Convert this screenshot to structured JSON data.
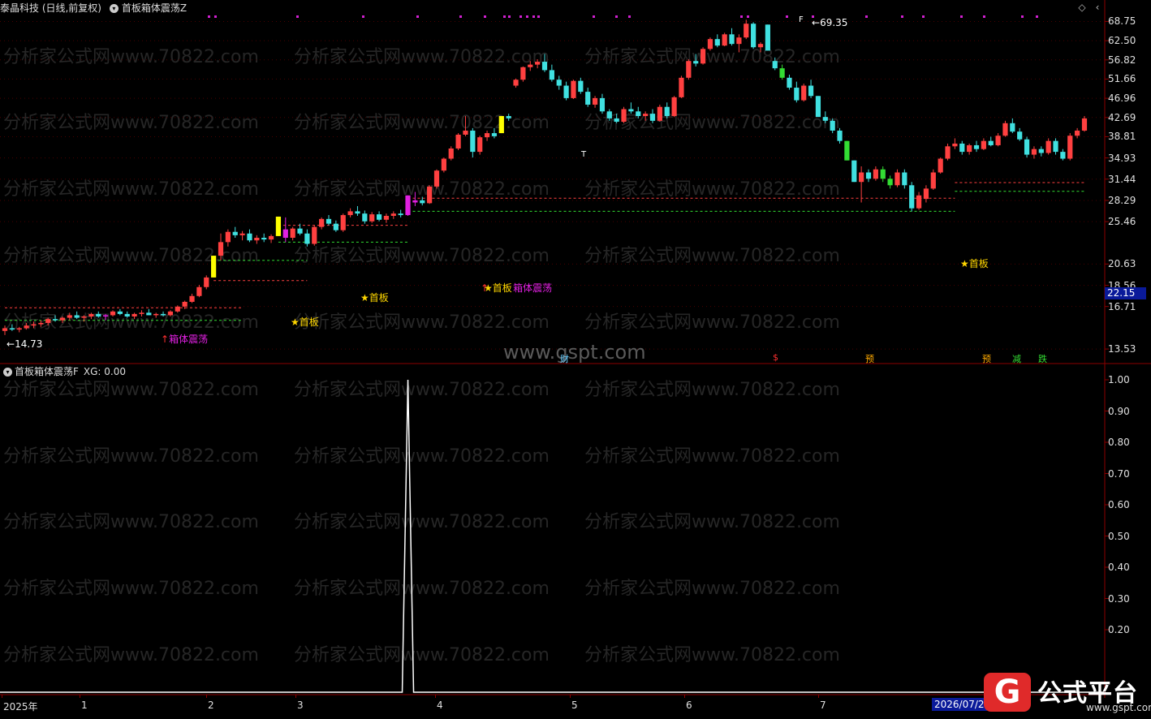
{
  "header": {
    "stock": "泰晶科技 (日线,前复权)",
    "indicator": "首板箱体震荡Z"
  },
  "indicator_panel": {
    "title": "首板箱体震荡F",
    "value_label": "XG: 0.00"
  },
  "current_price": "22.15",
  "price_axis": [
    "68.75",
    "62.50",
    "56.82",
    "51.66",
    "46.96",
    "42.69",
    "38.81",
    "34.93",
    "31.44",
    "28.29",
    "25.46",
    "20.63",
    "18.56",
    "16.71",
    "13.53"
  ],
  "indicator_axis": [
    "1.00",
    "0.90",
    "0.80",
    "0.70",
    "0.60",
    "0.50",
    "0.40",
    "0.30",
    "0.20"
  ],
  "time_axis": [
    "2025年",
    "1",
    "2",
    "3",
    "4",
    "5",
    "6",
    "7"
  ],
  "time_axis_end": "2026/07/2",
  "annotations": {
    "high": "69.35",
    "low": "14.73",
    "first_board": "首板",
    "box_oscillation": "箱体震荡",
    "cai": "财",
    "dollar": "$",
    "yu": "预",
    "jian": "减",
    "die": "跌",
    "t": "T",
    "f": "F"
  },
  "watermark_text": "分析家公式网www.70822.com",
  "site_watermark": "www.gspt.com",
  "logo": {
    "mark": "G",
    "text": "公式平台",
    "url": "www.gspt.com"
  },
  "colors": {
    "up": "#ff4040",
    "down": "#40e0e0",
    "limit_up": "#ffff00",
    "limit_down": "#33dd33",
    "signal": "#e020e0",
    "grid": "#8b0000"
  },
  "chart_data": {
    "type": "candlestick",
    "ylim": [
      13.0,
      70.0
    ],
    "candles": [
      [
        14.8,
        15.2,
        14.5,
        15.0
      ],
      [
        15.0,
        15.3,
        14.8,
        14.9
      ],
      [
        14.9,
        15.1,
        14.7,
        15.0
      ],
      [
        15.0,
        15.4,
        14.9,
        15.2
      ],
      [
        15.2,
        15.5,
        15.0,
        15.3
      ],
      [
        15.3,
        15.6,
        15.1,
        15.4
      ],
      [
        15.4,
        15.8,
        15.2,
        15.7
      ],
      [
        15.7,
        16.0,
        15.5,
        15.6
      ],
      [
        15.6,
        15.9,
        15.4,
        15.8
      ],
      [
        15.8,
        16.2,
        15.6,
        16.0
      ],
      [
        16.0,
        16.3,
        15.7,
        15.8
      ],
      [
        15.8,
        16.0,
        15.5,
        15.9
      ],
      [
        15.9,
        16.2,
        15.7,
        16.1
      ],
      [
        16.1,
        16.3,
        15.8,
        15.9
      ],
      [
        15.9,
        16.1,
        15.6,
        16.0
      ],
      [
        16.0,
        16.4,
        15.9,
        16.3
      ],
      [
        16.3,
        16.5,
        16.0,
        16.1
      ],
      [
        16.1,
        16.3,
        15.8,
        15.9
      ],
      [
        15.9,
        16.2,
        15.7,
        16.1
      ],
      [
        16.1,
        16.4,
        15.9,
        16.2
      ],
      [
        16.2,
        16.5,
        16.0,
        16.0
      ],
      [
        16.0,
        16.2,
        15.8,
        16.1
      ],
      [
        16.1,
        16.3,
        15.9,
        16.0
      ],
      [
        16.0,
        16.4,
        15.9,
        16.3
      ],
      [
        16.3,
        16.8,
        16.2,
        16.7
      ],
      [
        16.7,
        17.2,
        16.5,
        17.1
      ],
      [
        17.1,
        17.8,
        17.0,
        17.6
      ],
      [
        17.6,
        18.6,
        17.5,
        18.4
      ],
      [
        18.4,
        19.5,
        18.2,
        19.3
      ],
      [
        19.3,
        21.5,
        19.3,
        21.5
      ],
      [
        21.5,
        24.0,
        21.0,
        23.0
      ],
      [
        23.0,
        24.5,
        22.5,
        24.2
      ],
      [
        24.2,
        24.8,
        23.5,
        23.8
      ],
      [
        23.8,
        24.3,
        23.2,
        24.0
      ],
      [
        24.0,
        24.5,
        23.0,
        23.2
      ],
      [
        23.2,
        23.8,
        22.8,
        23.5
      ],
      [
        23.5,
        24.0,
        23.0,
        23.3
      ],
      [
        23.3,
        23.9,
        22.9,
        23.7
      ],
      [
        23.7,
        26.1,
        23.7,
        26.1
      ],
      [
        24.5,
        26.0,
        23.0,
        23.5
      ],
      [
        23.5,
        24.8,
        23.2,
        24.6
      ],
      [
        24.6,
        25.2,
        23.8,
        24.0
      ],
      [
        24.0,
        24.5,
        22.5,
        22.8
      ],
      [
        22.8,
        25.0,
        22.6,
        24.8
      ],
      [
        24.8,
        26.0,
        24.5,
        25.8
      ],
      [
        25.8,
        26.3,
        25.0,
        25.2
      ],
      [
        25.2,
        25.6,
        24.2,
        24.4
      ],
      [
        24.4,
        26.5,
        24.2,
        26.3
      ],
      [
        26.3,
        27.2,
        26.0,
        26.8
      ],
      [
        26.8,
        27.5,
        26.2,
        26.5
      ],
      [
        26.5,
        26.9,
        25.2,
        25.5
      ],
      [
        25.5,
        26.7,
        25.3,
        26.4
      ],
      [
        26.4,
        26.8,
        25.5,
        25.7
      ],
      [
        25.7,
        26.5,
        25.3,
        26.2
      ],
      [
        26.2,
        26.8,
        25.8,
        26.5
      ],
      [
        26.5,
        27.0,
        26.0,
        26.3
      ],
      [
        26.3,
        29.0,
        26.2,
        29.0
      ],
      [
        28.0,
        29.5,
        27.5,
        28.3
      ],
      [
        28.3,
        28.8,
        27.6,
        27.9
      ],
      [
        27.9,
        30.5,
        27.8,
        30.3
      ],
      [
        30.3,
        33.0,
        30.0,
        32.8
      ],
      [
        32.8,
        35.0,
        32.5,
        34.8
      ],
      [
        34.8,
        37.0,
        34.5,
        36.6
      ],
      [
        36.6,
        39.5,
        36.3,
        39.2
      ],
      [
        39.2,
        43.0,
        38.9,
        40.0
      ],
      [
        40.0,
        40.5,
        35.0,
        36.0
      ],
      [
        36.0,
        39.0,
        35.5,
        38.7
      ],
      [
        38.7,
        40.0,
        38.0,
        39.5
      ],
      [
        39.5,
        40.5,
        38.5,
        38.9
      ],
      [
        39.5,
        43.0,
        39.5,
        43.0
      ],
      [
        43.0,
        43.5,
        42.0,
        42.5
      ],
      [
        50.0,
        51.8,
        49.5,
        51.5
      ],
      [
        51.5,
        55.0,
        51.0,
        54.8
      ],
      [
        54.8,
        56.5,
        53.8,
        55.5
      ],
      [
        55.5,
        57.0,
        54.5,
        56.3
      ],
      [
        56.3,
        58.5,
        53.5,
        54.0
      ],
      [
        54.0,
        55.5,
        51.0,
        51.5
      ],
      [
        51.5,
        52.5,
        49.0,
        50.0
      ],
      [
        50.0,
        51.0,
        46.5,
        47.0
      ],
      [
        47.0,
        51.5,
        46.8,
        51.2
      ],
      [
        51.2,
        52.0,
        48.0,
        48.5
      ],
      [
        48.5,
        49.5,
        45.0,
        45.5
      ],
      [
        45.5,
        47.5,
        44.8,
        47.0
      ],
      [
        47.0,
        48.0,
        43.5,
        44.0
      ],
      [
        44.0,
        44.5,
        42.0,
        42.5
      ],
      [
        42.5,
        43.5,
        41.5,
        41.8
      ],
      [
        41.8,
        45.0,
        41.5,
        44.5
      ],
      [
        44.5,
        46.0,
        43.5,
        44.0
      ],
      [
        44.0,
        45.0,
        42.5,
        43.0
      ],
      [
        43.0,
        44.0,
        42.0,
        43.5
      ],
      [
        43.5,
        44.5,
        41.5,
        42.0
      ],
      [
        42.0,
        45.5,
        41.8,
        45.0
      ],
      [
        45.0,
        46.0,
        42.5,
        43.0
      ],
      [
        43.0,
        47.5,
        42.8,
        47.2
      ],
      [
        47.2,
        52.5,
        47.0,
        52.0
      ],
      [
        52.0,
        57.0,
        51.5,
        56.5
      ],
      [
        56.5,
        58.5,
        55.0,
        55.8
      ],
      [
        55.8,
        60.5,
        55.5,
        60.0
      ],
      [
        60.0,
        63.5,
        59.5,
        63.0
      ],
      [
        63.0,
        64.5,
        60.5,
        61.0
      ],
      [
        61.0,
        65.0,
        60.8,
        64.5
      ],
      [
        64.5,
        66.5,
        61.0,
        61.5
      ],
      [
        61.5,
        64.5,
        59.0,
        63.5
      ],
      [
        63.5,
        69.35,
        63.0,
        68.0
      ],
      [
        68.0,
        68.5,
        60.0,
        60.5
      ],
      [
        60.5,
        62.0,
        59.0,
        61.5
      ],
      [
        67.7,
        67.7,
        59.5,
        59.5
      ],
      [
        56.5,
        57.5,
        54.0,
        54.5
      ],
      [
        54.5,
        55.5,
        51.5,
        52.0
      ],
      [
        52.0,
        52.8,
        49.0,
        49.5
      ],
      [
        49.5,
        51.0,
        46.0,
        46.5
      ],
      [
        46.5,
        50.5,
        46.2,
        50.0
      ],
      [
        50.0,
        51.5,
        47.0,
        47.5
      ],
      [
        47.5,
        47.5,
        42.8,
        42.8
      ],
      [
        42.8,
        44.0,
        41.5,
        42.0
      ],
      [
        42.0,
        42.5,
        39.5,
        40.0
      ],
      [
        40.0,
        40.5,
        37.5,
        38.0
      ],
      [
        38.0,
        38.0,
        34.5,
        34.5
      ],
      [
        34.5,
        34.5,
        31.0,
        31.0
      ],
      [
        31.0,
        33.5,
        28.0,
        32.5
      ],
      [
        32.5,
        33.0,
        31.0,
        31.5
      ],
      [
        31.5,
        33.5,
        31.2,
        33.0
      ],
      [
        33.0,
        33.5,
        31.0,
        31.5
      ],
      [
        31.5,
        32.0,
        30.0,
        30.5
      ],
      [
        30.5,
        33.0,
        30.2,
        32.5
      ],
      [
        32.5,
        33.0,
        30.0,
        30.5
      ],
      [
        30.5,
        31.0,
        26.8,
        27.2
      ],
      [
        27.2,
        29.5,
        27.0,
        29.0
      ],
      [
        28.5,
        30.5,
        28.0,
        30.0
      ],
      [
        30.0,
        33.0,
        29.8,
        32.5
      ],
      [
        32.5,
        35.0,
        32.3,
        34.8
      ],
      [
        34.8,
        37.5,
        34.5,
        37.0
      ],
      [
        37.0,
        38.5,
        36.5,
        37.5
      ],
      [
        37.5,
        38.0,
        35.5,
        36.0
      ],
      [
        36.0,
        37.5,
        35.5,
        37.2
      ],
      [
        37.2,
        38.0,
        36.0,
        36.5
      ],
      [
        36.5,
        38.5,
        36.3,
        38.0
      ],
      [
        38.0,
        38.8,
        37.0,
        37.2
      ],
      [
        37.2,
        39.5,
        37.0,
        39.0
      ],
      [
        39.0,
        42.0,
        38.8,
        41.5
      ],
      [
        41.5,
        42.5,
        39.5,
        39.8
      ],
      [
        39.8,
        40.5,
        38.0,
        38.3
      ],
      [
        38.3,
        38.8,
        35.0,
        35.5
      ],
      [
        35.5,
        37.0,
        34.8,
        36.5
      ],
      [
        36.5,
        37.0,
        35.2,
        35.8
      ],
      [
        35.8,
        38.5,
        35.5,
        38.0
      ],
      [
        38.0,
        38.5,
        35.5,
        36.0
      ],
      [
        36.0,
        36.5,
        34.5,
        34.8
      ],
      [
        34.8,
        39.5,
        34.5,
        39.0
      ],
      [
        39.0,
        40.5,
        38.5,
        40.0
      ],
      [
        40.0,
        43.0,
        39.8,
        42.5
      ]
    ],
    "limit_up_days": [
      29,
      38,
      56,
      69
    ],
    "limit_down_days": [
      108,
      117,
      122,
      123
    ],
    "first_board_days": [
      29,
      38,
      56,
      132
    ],
    "box_days": [
      14,
      56
    ],
    "indicator": {
      "ylim": [
        0,
        1
      ],
      "spike_day": 56,
      "spike_value": 1.0
    }
  }
}
